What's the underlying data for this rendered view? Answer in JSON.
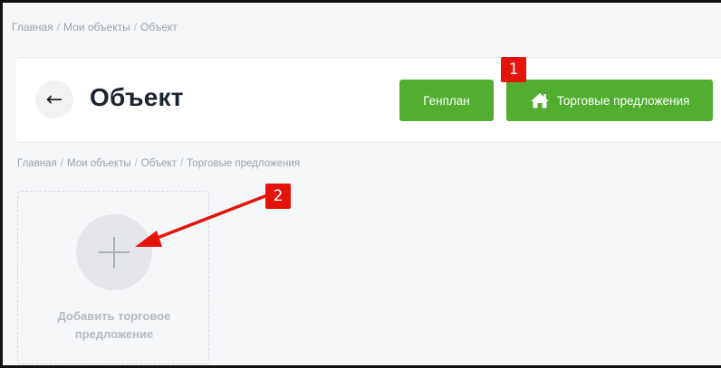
{
  "breadcrumb_top": {
    "items": [
      "Главная",
      "Мои объекты",
      "Объект"
    ],
    "separator": "/"
  },
  "header": {
    "back_glyph": "←",
    "title": "Объект",
    "buttons": {
      "genplan": "Генплан",
      "trade_offers": "Торговые предложения"
    }
  },
  "breadcrumb_sub": {
    "items": [
      "Главная",
      "Мои объекты",
      "Объект",
      "Торговые предложения"
    ],
    "separator": "/"
  },
  "add_card": {
    "line1": "Добавить торговое",
    "line2": "предложение"
  },
  "annotations": {
    "marker1": "1",
    "marker2": "2"
  },
  "colors": {
    "accent_green": "#52ae30",
    "annotation_red": "#e5140a"
  },
  "icons": {
    "back": "arrow-left-icon",
    "trade_offers": "home-icon",
    "add": "plus-icon"
  }
}
